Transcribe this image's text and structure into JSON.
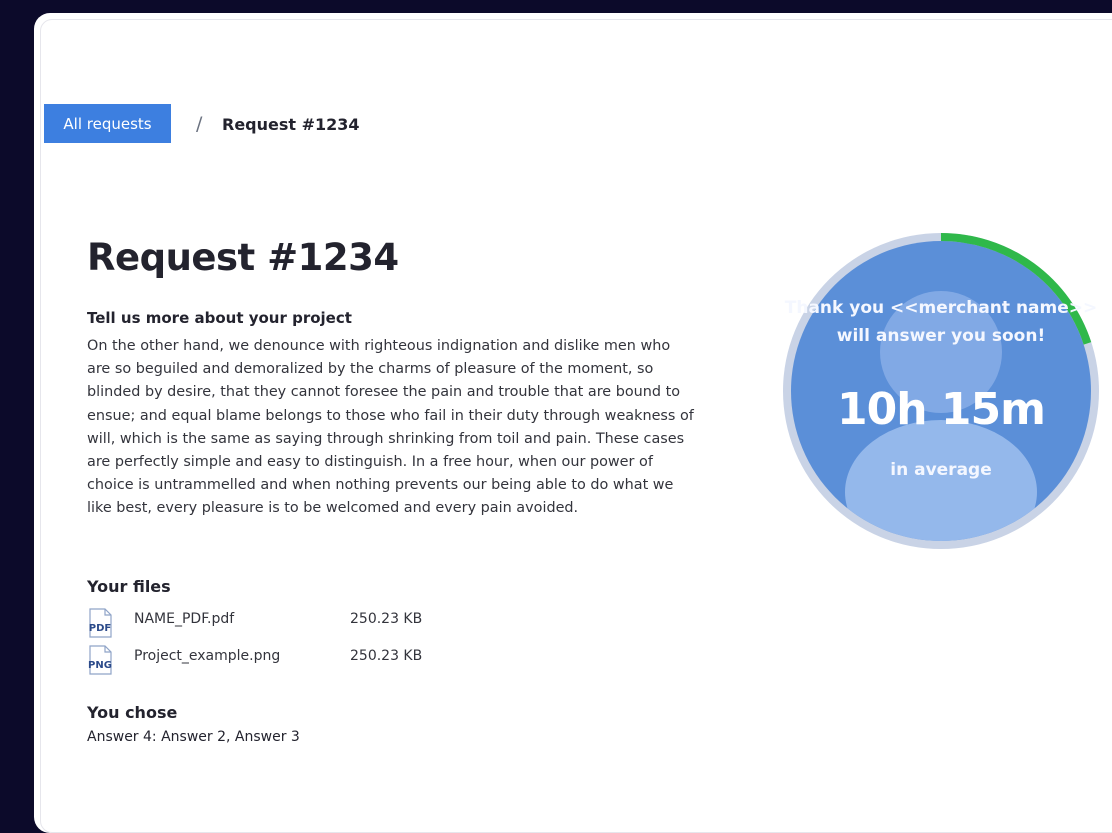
{
  "breadcrumb": {
    "all_requests_label": "All requests",
    "separator": "/",
    "current": "Request #1234"
  },
  "page": {
    "title": "Request #1234",
    "subtitle": "Tell us more about your project",
    "description": "On the other hand, we denounce with righteous indignation and dislike men who are so beguiled and demoralized by the charms of pleasure of the moment, so blinded by desire, that they cannot foresee the pain and trouble that are bound to ensue; and equal blame belongs to those who fail in their duty through weakness of will, which is the same as saying through shrinking from toil and pain. These cases are perfectly simple and easy to distinguish. In a free hour, when our power of choice is untrammelled and when nothing prevents our being able to do what we like best, every pleasure is to be welcomed and every pain avoided."
  },
  "files": {
    "title": "Your files",
    "items": [
      {
        "icon": "pdf-file-icon",
        "type_label": "PDF",
        "name": "NAME_PDF.pdf",
        "size": "250.23 KB"
      },
      {
        "icon": "png-file-icon",
        "type_label": "PNG",
        "name": "Project_example.png",
        "size": "250.23 KB"
      }
    ]
  },
  "choice": {
    "title": "You chose",
    "value": "Answer 4: Answer 2, Answer 3"
  },
  "timer": {
    "message": "Thank you <<merchant name>> will answer you soon!",
    "time": "10h 15m",
    "caption": "in average",
    "progress_fraction": 0.2,
    "colors": {
      "circle": "#5b8fd8",
      "ring": "#c9d3e6",
      "progress": "#2fb84a"
    }
  },
  "colors": {
    "accent": "#3d7fe0",
    "background": "#0c0a2a"
  }
}
